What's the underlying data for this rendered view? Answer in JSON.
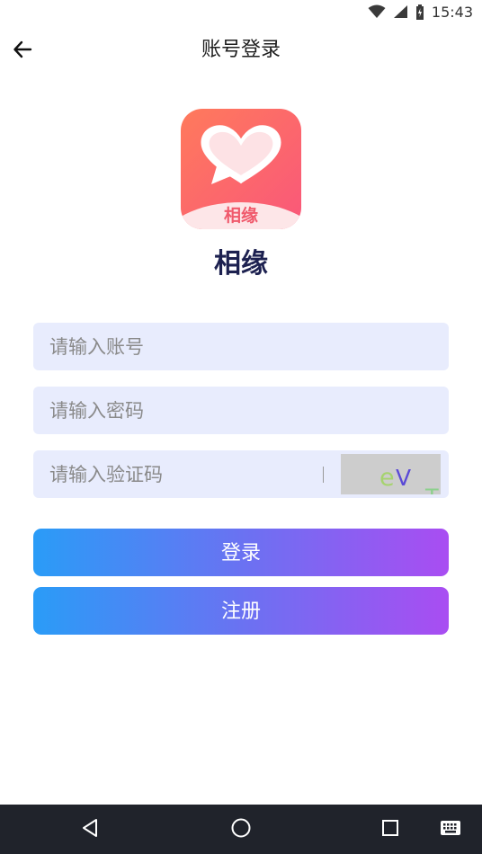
{
  "status_bar": {
    "time": "15:43"
  },
  "header": {
    "title": "账号登录"
  },
  "logo": {
    "text": "相缘"
  },
  "app": {
    "name": "相缘"
  },
  "form": {
    "account_placeholder": "请输入账号",
    "account_value": "",
    "password_placeholder": "请输入密码",
    "password_value": "",
    "captcha_placeholder": "请输入验证码",
    "captcha_value": "",
    "captcha_chars": [
      "e",
      "V",
      "T"
    ]
  },
  "buttons": {
    "login_label": "登录",
    "register_label": "注册"
  },
  "icons": {
    "back": "back-arrow-icon",
    "wifi": "wifi-icon",
    "signal": "signal-icon",
    "battery": "battery-icon",
    "nav_back": "triangle-back-icon",
    "nav_home": "circle-home-icon",
    "nav_recents": "square-recents-icon",
    "nav_keyboard": "keyboard-icon"
  },
  "colors": {
    "field_bg": "#e8ecfd",
    "button_gradient_start": "#2a9cf7",
    "button_gradient_end": "#a94df2",
    "logo_gradient_start": "#ff7a5c",
    "logo_gradient_end": "#f9577a",
    "app_name": "#1d2150",
    "nav_bar": "#20232b"
  }
}
